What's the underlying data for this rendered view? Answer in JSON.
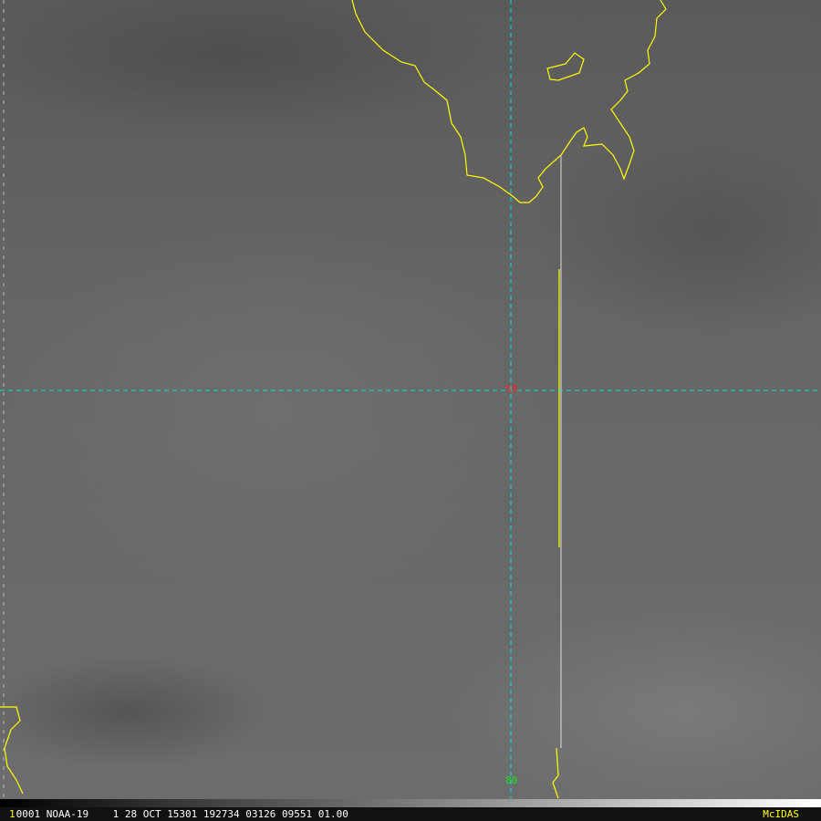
{
  "image": {
    "frame_number": "1",
    "header": "0001 NOAA-19    1 28 OCT 15301 192734 03126 09551 01.00",
    "brand": "McIDAS"
  },
  "grid_labels": {
    "lat_label": "50",
    "lon_label": "80"
  },
  "colors": {
    "coastline": "#ffff00",
    "grid": "#00e0e0",
    "lat_label": "#ff2020",
    "lon_label": "#20e020"
  }
}
